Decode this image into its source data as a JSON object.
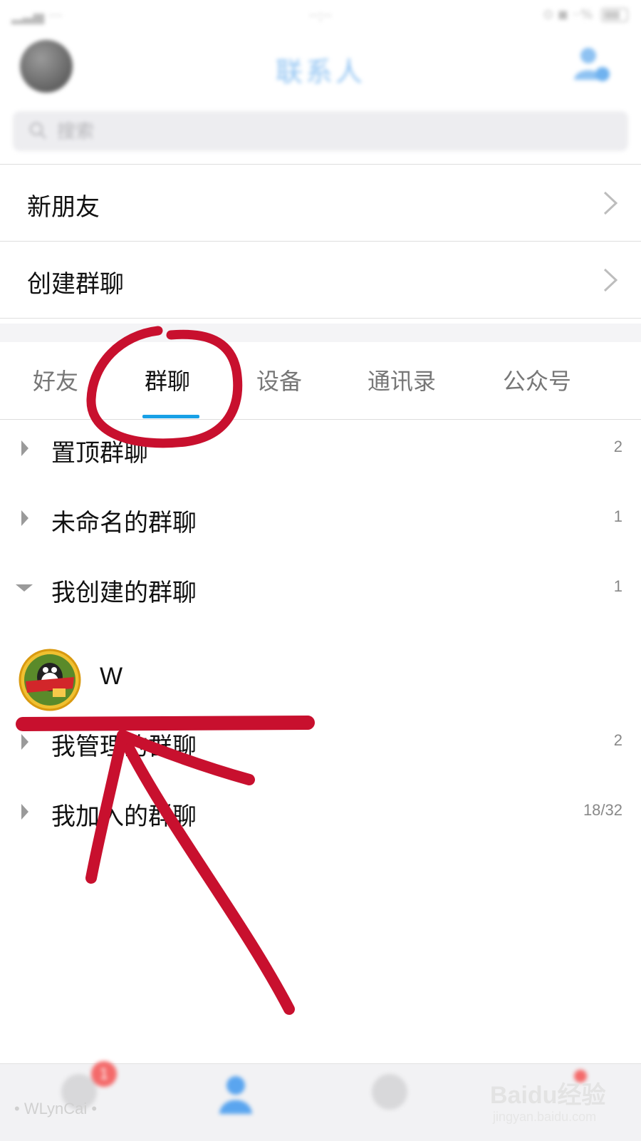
{
  "header": {
    "title": "联系人"
  },
  "search": {
    "placeholder": "搜索"
  },
  "menu": [
    {
      "label": "新朋友"
    },
    {
      "label": "创建群聊"
    }
  ],
  "tabs": [
    "好友",
    "群聊",
    "设备",
    "通讯录",
    "公众号"
  ],
  "active_tab": "群聊",
  "groups": [
    {
      "label": "置顶群聊",
      "count": "2",
      "expanded": false
    },
    {
      "label": "未命名的群聊",
      "count": "1",
      "expanded": false
    },
    {
      "label": "我创建的群聊",
      "count": "1",
      "expanded": true
    },
    {
      "label": "我管理的群聊",
      "count": "2",
      "expanded": false
    },
    {
      "label": "我加入的群聊",
      "count": "18/32",
      "expanded": false
    }
  ],
  "created_chat": {
    "name": "W"
  },
  "tabbar": {
    "badge": "1"
  },
  "watermark": {
    "user": "• WLynCai •",
    "brand": "Baidu经验",
    "url": "jingyan.baidu.com"
  },
  "colors": {
    "accent": "#18a0e6",
    "annotation": "#c8102e",
    "title": "#8ec2f2"
  }
}
